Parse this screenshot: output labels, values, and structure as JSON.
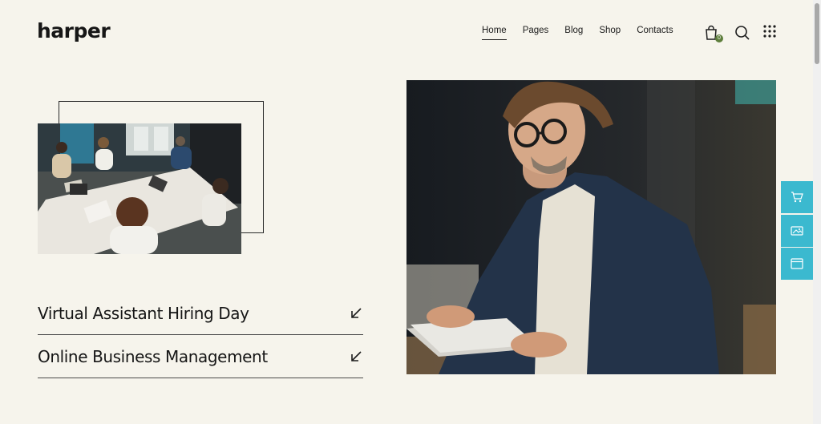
{
  "brand": {
    "logo": "harper"
  },
  "nav": {
    "items": [
      "Home",
      "Pages",
      "Blog",
      "Shop",
      "Contacts"
    ],
    "active": "Home"
  },
  "header": {
    "cart_count": "0"
  },
  "list": {
    "items": [
      {
        "title": "Virtual Assistant Hiring Day"
      },
      {
        "title": "Online Business Management"
      }
    ]
  },
  "images": {
    "meeting": "team-meeting-photo",
    "portrait": "man-with-tablet-photo"
  },
  "colors": {
    "background": "#f6f4ec",
    "accent": "#3bb9cf",
    "badge": "#5e7e3c",
    "text": "#1c1c1c"
  }
}
